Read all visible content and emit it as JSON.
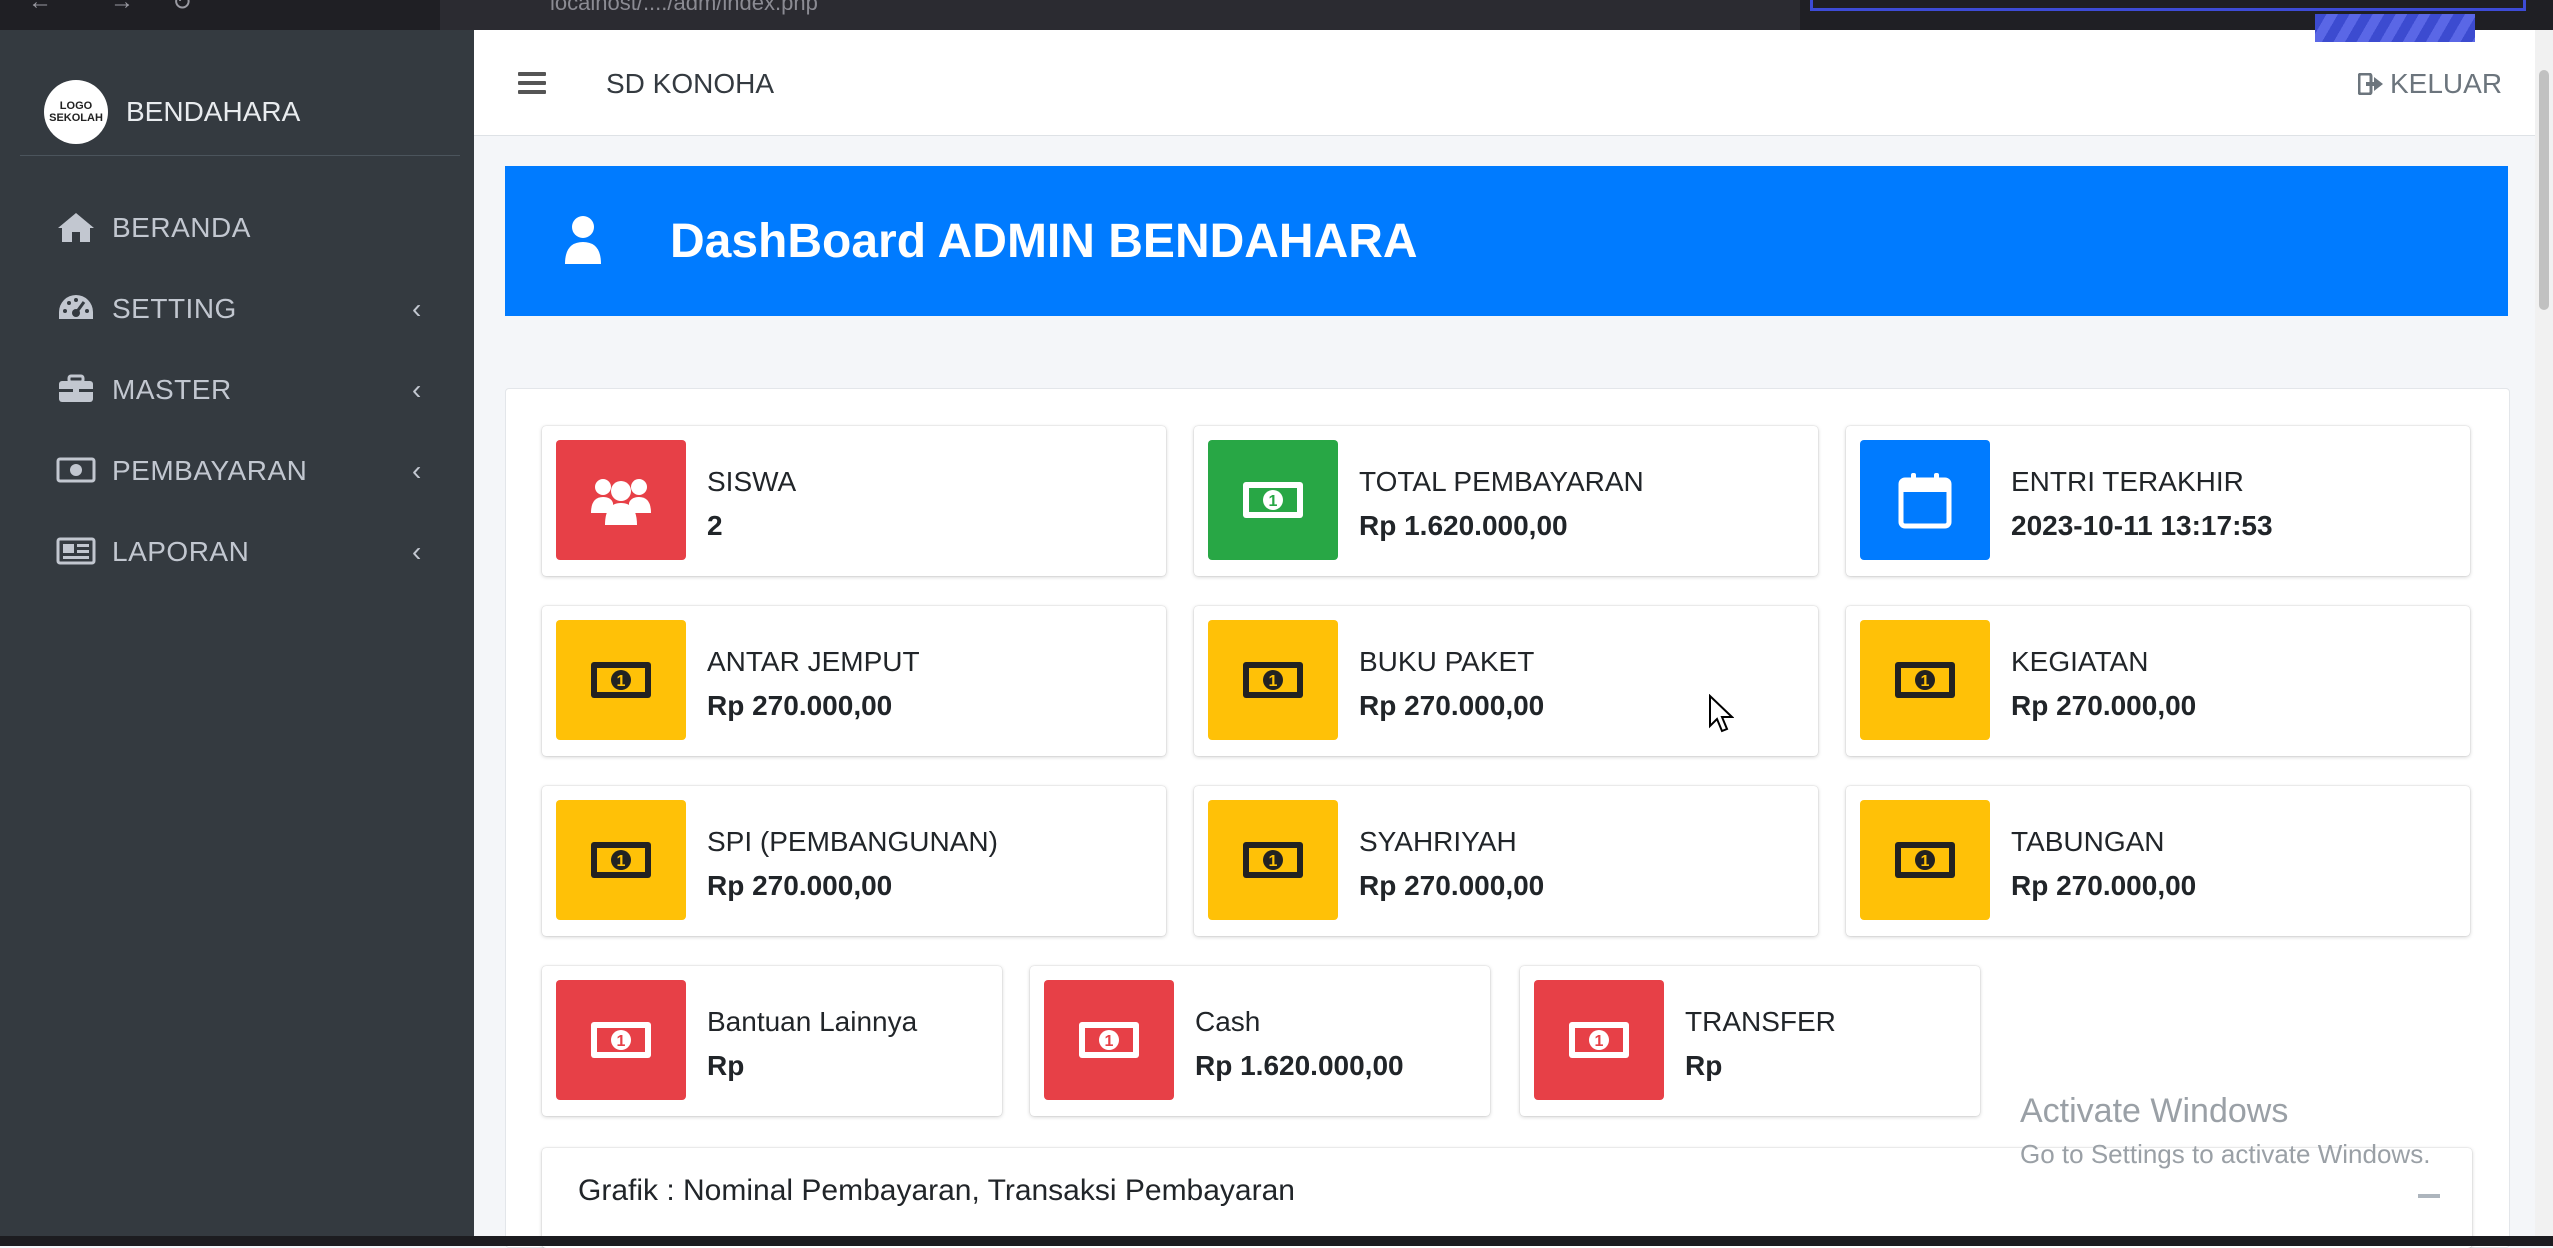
{
  "browser": {
    "url": "localhost/..../adm/index.php"
  },
  "sidebar": {
    "logo_text": "LOGO SEKOLAH",
    "brand": "BENDAHARA",
    "items": [
      {
        "label": "BERANDA",
        "icon": "home-icon",
        "has_submenu": false
      },
      {
        "label": "SETTING",
        "icon": "dashboard-gauge-icon",
        "has_submenu": true
      },
      {
        "label": "MASTER",
        "icon": "briefcase-icon",
        "has_submenu": true
      },
      {
        "label": "PEMBAYARAN",
        "icon": "money-icon",
        "has_submenu": true
      },
      {
        "label": "LAPORAN",
        "icon": "newspaper-icon",
        "has_submenu": true
      }
    ]
  },
  "topbar": {
    "school_name": "SD KONOHA",
    "logout_label": "KELUAR"
  },
  "header": {
    "title": "DashBoard ADMIN BENDAHARA"
  },
  "colors": {
    "primary": "#007bff",
    "danger": "#dc3545",
    "success": "#28a745",
    "warning": "#ffc107",
    "sidebar": "#343a40"
  },
  "stats": [
    {
      "label": "SISWA",
      "value": "2",
      "color": "danger",
      "icon": "users-icon"
    },
    {
      "label": "TOTAL PEMBAYARAN",
      "value": "Rp 1.620.000,00",
      "color": "success",
      "icon": "money-bill-icon"
    },
    {
      "label": "ENTRI TERAKHIR",
      "value": "2023-10-11 13:17:53",
      "color": "primary",
      "icon": "calendar-icon"
    },
    {
      "label": "ANTAR JEMPUT",
      "value": "Rp 270.000,00",
      "color": "warning",
      "icon": "money-bill-icon"
    },
    {
      "label": "BUKU PAKET",
      "value": "Rp 270.000,00",
      "color": "warning",
      "icon": "money-bill-icon"
    },
    {
      "label": "KEGIATAN",
      "value": "Rp 270.000,00",
      "color": "warning",
      "icon": "money-bill-icon"
    },
    {
      "label": "SPI (PEMBANGUNAN)",
      "value": "Rp 270.000,00",
      "color": "warning",
      "icon": "money-bill-icon"
    },
    {
      "label": "SYAHRIYAH",
      "value": "Rp 270.000,00",
      "color": "warning",
      "icon": "money-bill-icon"
    },
    {
      "label": "TABUNGAN",
      "value": "Rp 270.000,00",
      "color": "warning",
      "icon": "money-bill-icon"
    },
    {
      "label": "Bantuan Lainnya",
      "value": "Rp",
      "color": "danger",
      "icon": "money-bill-icon"
    },
    {
      "label": "Cash",
      "value": "Rp 1.620.000,00",
      "color": "danger",
      "icon": "money-bill-icon"
    },
    {
      "label": "TRANSFER",
      "value": "Rp",
      "color": "danger",
      "icon": "money-bill-icon"
    }
  ],
  "grafik": {
    "title": "Grafik : Nominal Pembayaran, Transaksi Pembayaran"
  },
  "watermark": {
    "line1": "Activate Windows",
    "line2": "Go to Settings to activate Windows."
  }
}
